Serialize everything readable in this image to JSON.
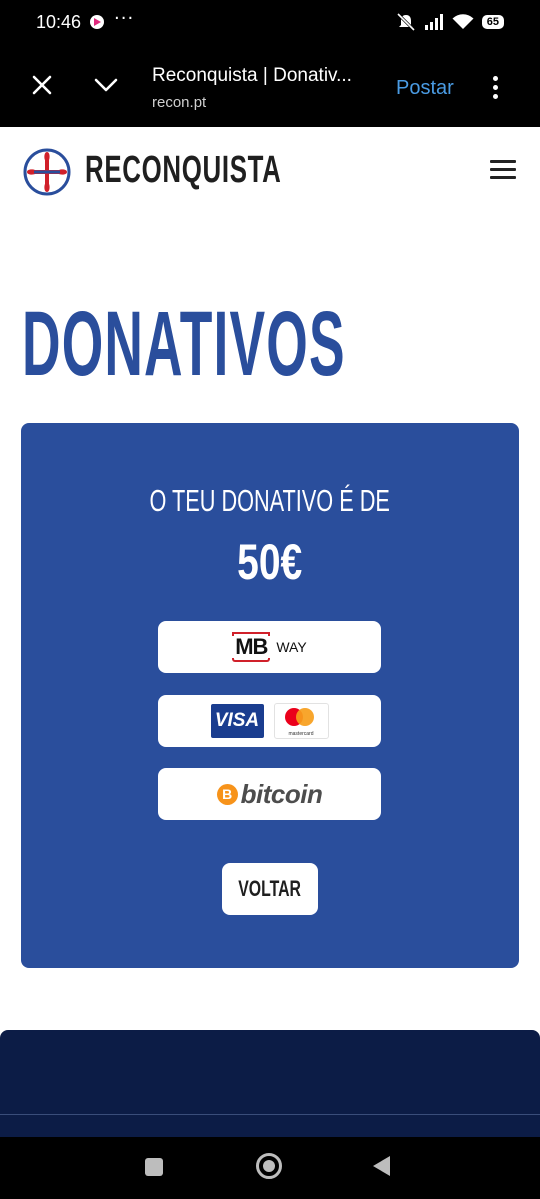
{
  "status_bar": {
    "time": "10:46",
    "more": "···",
    "battery": "65"
  },
  "browser": {
    "page_title": "Reconquista | Donativ...",
    "url": "recon.pt",
    "post_label": "Postar",
    "icons": [
      "close-icon",
      "chevron-down-icon",
      "more-vert-icon"
    ]
  },
  "header": {
    "brand": "RECONQUISTA",
    "icons": [
      "cross-logo-icon",
      "hamburger-menu-icon"
    ]
  },
  "main": {
    "title": "DONATIVOS",
    "donation_label": "O TEU DONATIVO É DE",
    "donation_amount": "50€",
    "payment_options": [
      {
        "id": "mbway",
        "mark": "MB",
        "label": "WAY"
      },
      {
        "id": "cards",
        "visa": "VISA",
        "mastercard": "mastercard"
      },
      {
        "id": "bitcoin",
        "symbol": "B",
        "label": "bitcoin"
      }
    ],
    "back_label": "VOLTAR"
  },
  "colors": {
    "primary_blue": "#2a4e9c",
    "footer_navy": "#0c1c46",
    "link_blue": "#4a9be3",
    "mb_red": "#d0202a",
    "visa_blue": "#1a3d8f",
    "mc_red": "#eb001b",
    "mc_orange": "#f79e1b",
    "btc_orange": "#f7931a"
  }
}
